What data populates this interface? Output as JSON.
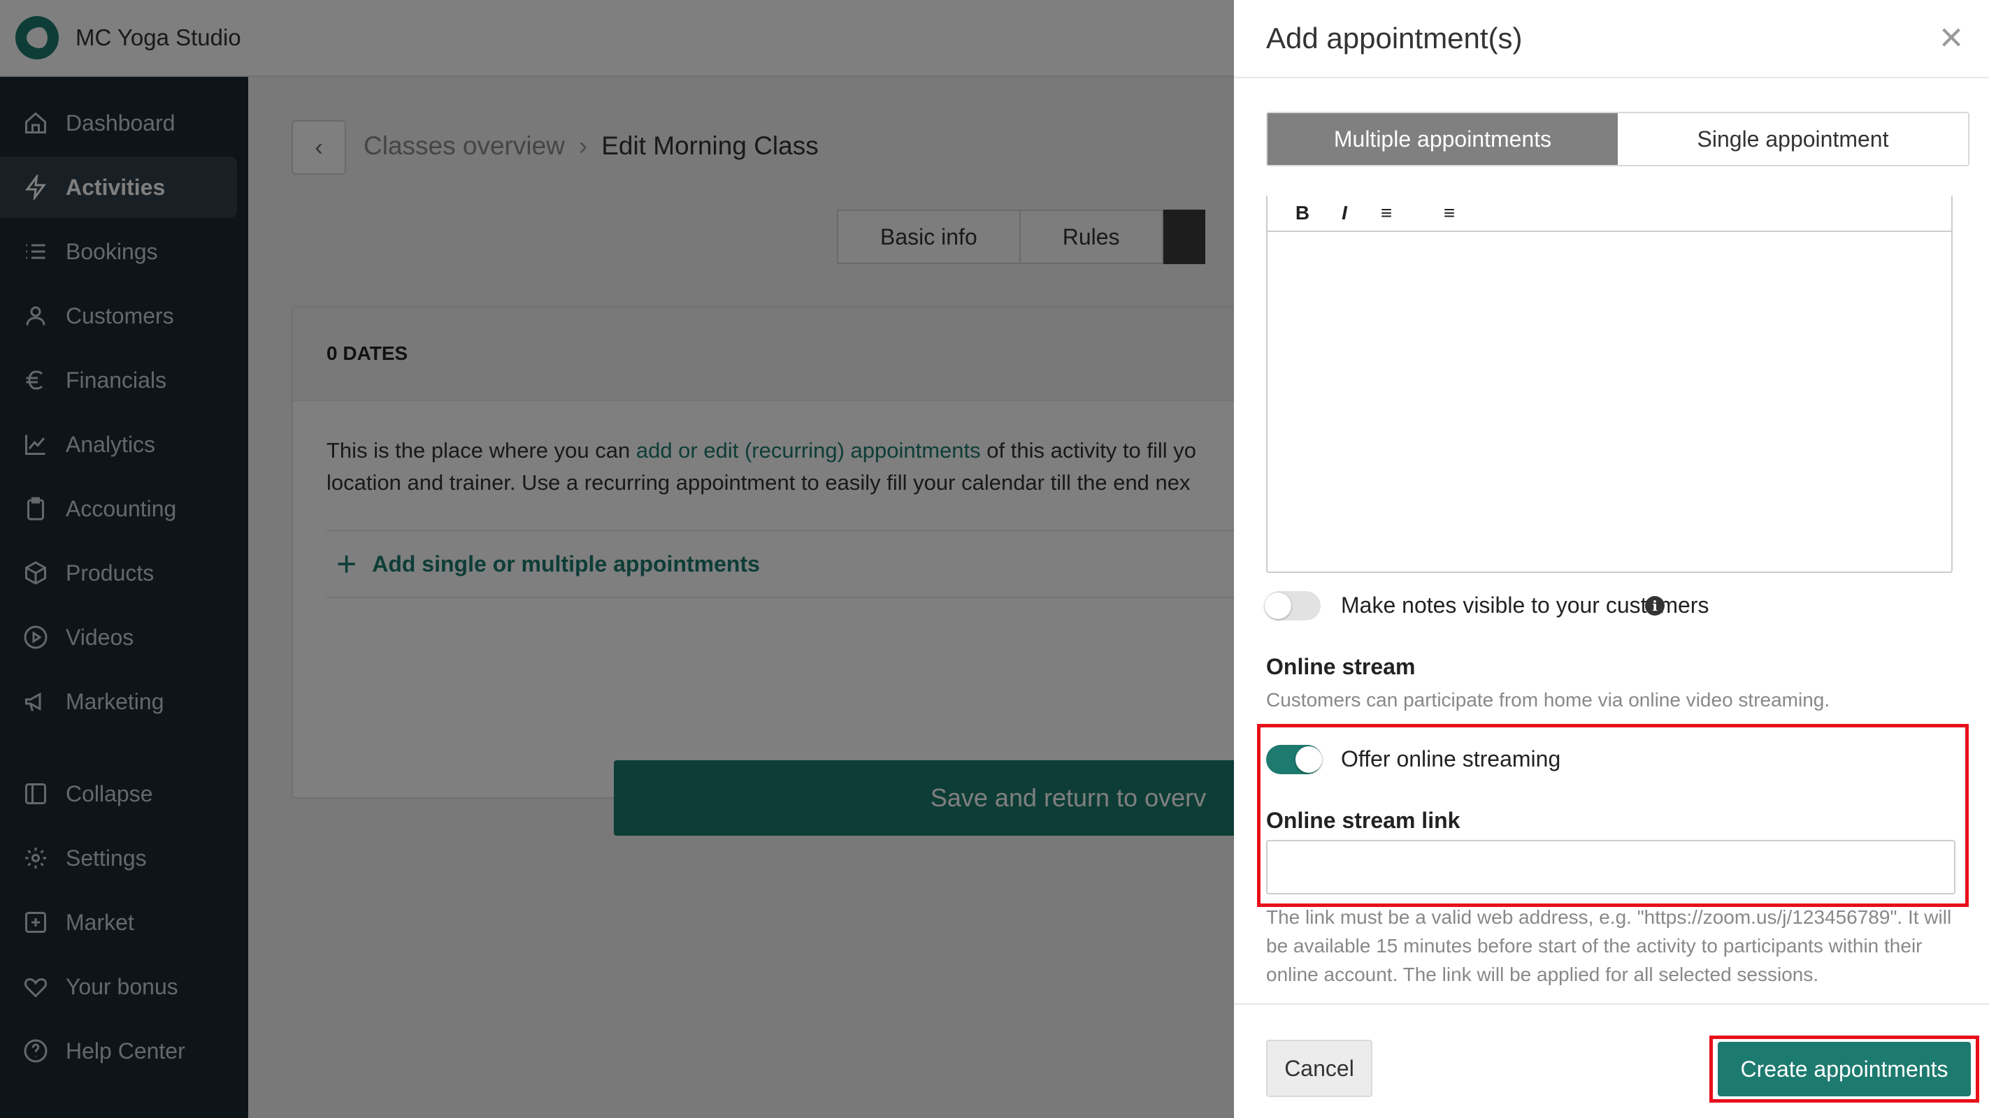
{
  "header": {
    "studio_name": "MC Yoga Studio"
  },
  "sidebar": {
    "items": [
      {
        "label": "Dashboard",
        "icon": "home-icon"
      },
      {
        "label": "Activities",
        "icon": "bolt-icon",
        "active": true
      },
      {
        "label": "Bookings",
        "icon": "list-icon"
      },
      {
        "label": "Customers",
        "icon": "user-icon"
      },
      {
        "label": "Financials",
        "icon": "euro-icon"
      },
      {
        "label": "Analytics",
        "icon": "chart-line-icon"
      },
      {
        "label": "Accounting",
        "icon": "clipboard-icon"
      },
      {
        "label": "Products",
        "icon": "box-icon"
      },
      {
        "label": "Videos",
        "icon": "play-circle-icon"
      },
      {
        "label": "Marketing",
        "icon": "megaphone-icon"
      }
    ],
    "bottom_items": [
      {
        "label": "Collapse",
        "icon": "sidebar-collapse-icon"
      },
      {
        "label": "Settings",
        "icon": "gear-icon"
      },
      {
        "label": "Market",
        "icon": "plus-square-icon"
      },
      {
        "label": "Your bonus",
        "icon": "heart-icon"
      },
      {
        "label": "Help Center",
        "icon": "help-circle-icon"
      }
    ]
  },
  "main": {
    "breadcrumb": {
      "parent": "Classes overview",
      "current": "Edit Morning Class"
    },
    "tabs": [
      "Basic info",
      "Rules"
    ],
    "dates_heading": "0 DATES",
    "intro_prefix": "This is the place where you can ",
    "intro_link": "add or edit (recurring) appointments",
    "intro_suffix": " of this activity to fill yo",
    "intro_line2": "location and trainer. Use a recurring appointment to easily fill your calendar till the end nex",
    "add_link": "Add single or multiple appointments",
    "save_button": "Save and return to overv"
  },
  "drawer": {
    "title": "Add appointment(s)",
    "segments": [
      "Multiple appointments",
      "Single appointment"
    ],
    "active_segment": "Multiple appointments",
    "notes_toggle": {
      "label": "Make notes visible to your customers",
      "on": false
    },
    "online_stream": {
      "title": "Online stream",
      "description": "Customers can participate from home via online video streaming.",
      "toggle_label": "Offer online streaming",
      "toggle_on": true,
      "link_label": "Online stream link",
      "link_value": "",
      "help": "The link must be a valid web address, e.g. \"https://zoom.us/j/123456789\". It will be available 15 minutes before start of the activity to participants within their online account. The link will be applied for all selected sessions."
    },
    "cancel_button": "Cancel",
    "create_button": "Create appointments"
  },
  "colors": {
    "accent": "#1d7a6e",
    "sidebar_bg": "#1d2a33",
    "highlight": "#e8101a"
  }
}
